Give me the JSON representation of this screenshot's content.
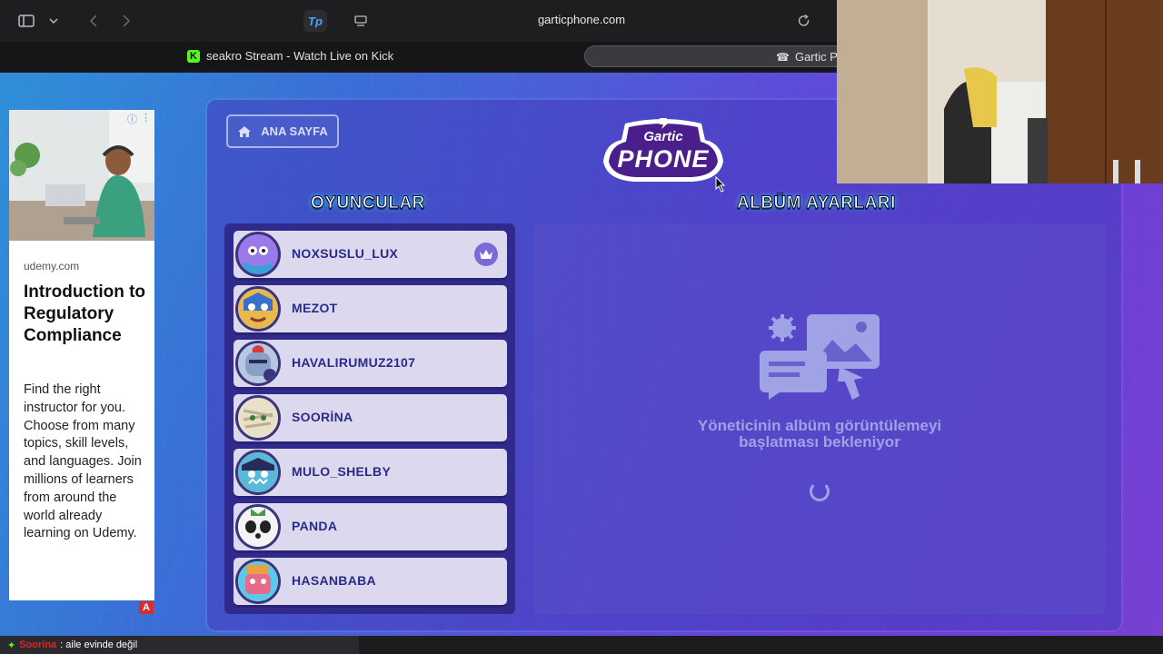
{
  "browser": {
    "url": "garticphone.com",
    "tp_label": "Tp",
    "tab1_title": "seakro Stream - Watch Live on Kick",
    "tab1_icon": "K",
    "tab2_title": "Gartic P"
  },
  "ad": {
    "source": "udemy.com",
    "title": "Introduction to Regulatory Compliance",
    "description": "Find the right instructor for you. Choose from many topics, skill levels, and languages. Join millions of learners from around the world already learning on Udemy.",
    "badge": "A"
  },
  "game": {
    "home_button": "ANA SAYFA",
    "logo_top": "Gartic",
    "logo_bottom": "PHONE",
    "players_title": "OYUNCULAR",
    "album_title": "ALBÜM AYARLARI",
    "waiting_text": "Yöneticinin albüm görüntülemeyi başlatması bekleniyor",
    "players": [
      {
        "name": "NOXSUSLU_LUX",
        "host": true,
        "color": "#7a5ad8"
      },
      {
        "name": "MEZOT",
        "host": false,
        "color": "#e8b84a"
      },
      {
        "name": "HAVALIRUMUZ2107",
        "host": false,
        "color": "#8aa0c8"
      },
      {
        "name": "SOORİNA",
        "host": false,
        "color": "#d8d0b0"
      },
      {
        "name": "MULO_SHELBY",
        "host": false,
        "color": "#5ab8d8"
      },
      {
        "name": "PANDA",
        "host": false,
        "color": "#f0f0f0"
      },
      {
        "name": "HASANBABA",
        "host": false,
        "color": "#e8a040"
      }
    ]
  },
  "chat": {
    "user": "Soorina",
    "message": ": aile evinde değil"
  }
}
